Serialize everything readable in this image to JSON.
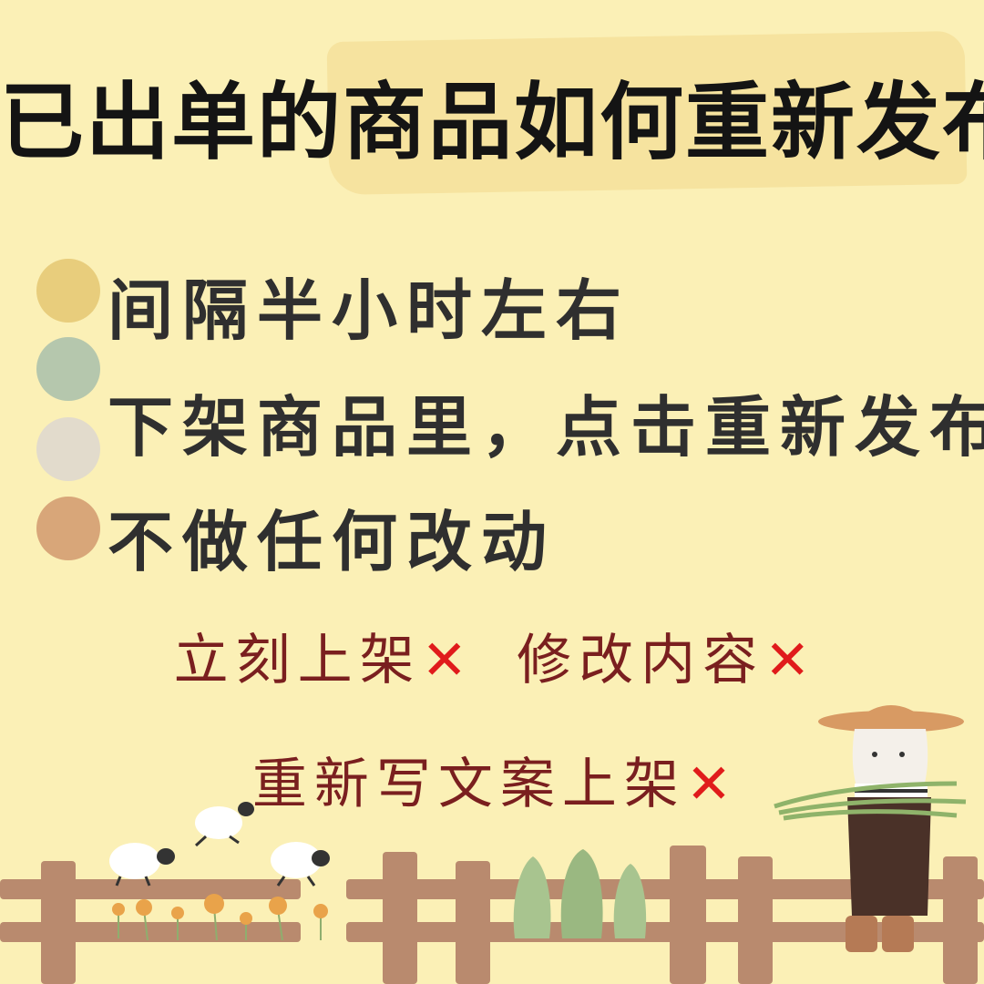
{
  "title": "已出单的商品如何重新发布",
  "steps": [
    {
      "text": "间隔半小时左右",
      "dot_color": "#e8cd7c"
    },
    {
      "text": "下架商品里，点击重新发布",
      "dot_color": "#b5c7ad"
    },
    {
      "text": "",
      "dot_color": "#e2dbcc"
    },
    {
      "text": "不做任何改动",
      "dot_color": "#d8a679"
    }
  ],
  "donts": {
    "row1": [
      "立刻上架",
      "修改内容"
    ],
    "row2": [
      "重新写文案上架"
    ],
    "mark": "✕"
  },
  "colors": {
    "background": "#fbf0b6",
    "title": "#141414",
    "dont_text": "#7a1f1f",
    "cross": "#e01b1b",
    "fence": "#b98a6e"
  }
}
